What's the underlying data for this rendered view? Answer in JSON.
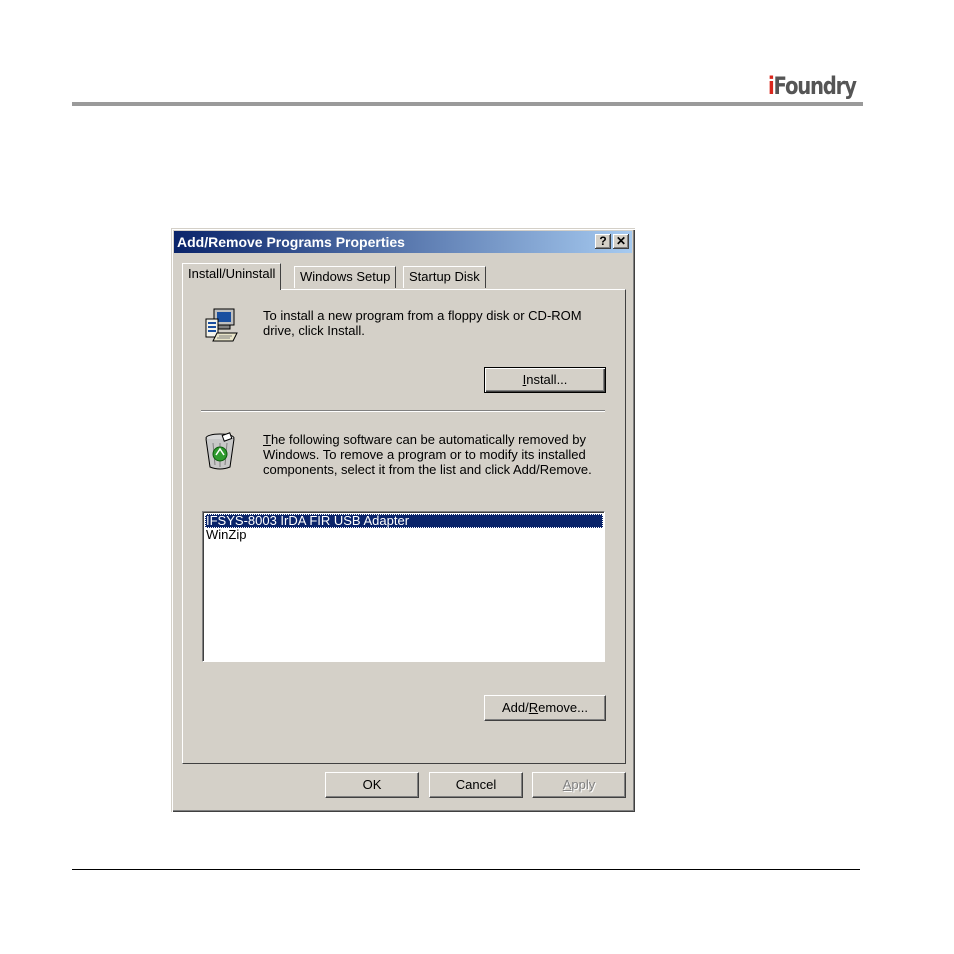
{
  "header": {
    "logo_mark": "i",
    "logo_text": "Foundry"
  },
  "dialog": {
    "title": "Add/Remove Programs Properties",
    "help_glyph": "?",
    "close_glyph": "✕",
    "tabs": [
      {
        "label": "Install/Uninstall",
        "active": true
      },
      {
        "label": "Windows Setup",
        "active": false
      },
      {
        "label": "Startup Disk",
        "active": false
      }
    ],
    "install_text": "To install a new program from a floppy disk or CD-ROM drive, click Install.",
    "install_button": {
      "pre": "",
      "key": "I",
      "post": "nstall..."
    },
    "remove_text": {
      "key": "T",
      "rest": "he following software can be automatically removed by Windows. To remove a program or to modify its installed components, select it from the list and click Add/Remove."
    },
    "programs": [
      {
        "name": "IFSYS-8003 IrDA FIR USB Adapter",
        "selected": true
      },
      {
        "name": "WinZip",
        "selected": false
      }
    ],
    "addremove_button": {
      "pre": "Add/",
      "key": "R",
      "post": "emove..."
    },
    "ok_label": "OK",
    "cancel_label": "Cancel",
    "apply_button": {
      "pre": "",
      "key": "A",
      "post": "pply"
    }
  },
  "icons": {
    "installer": "install-program-icon",
    "recycle": "recycle-bin-icon"
  }
}
